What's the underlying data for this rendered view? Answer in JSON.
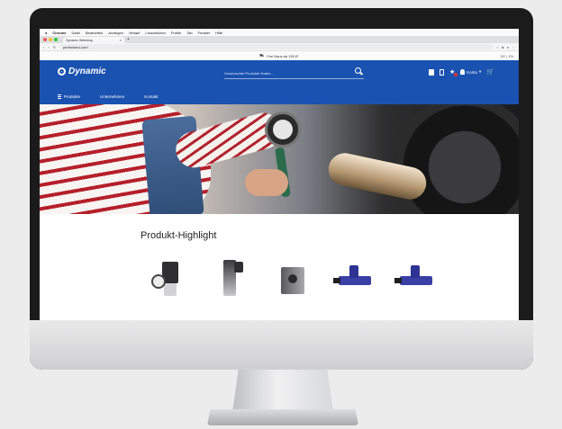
{
  "browser": {
    "menubar": [
      "Chrome",
      "Datei",
      "Bearbeiten",
      "Anzeigen",
      "Verlauf",
      "Lesezeichen",
      "Profile",
      "Tab",
      "Fenster",
      "Hilfe"
    ],
    "tab_title": "Dynamic Webshop",
    "tab_close": "×",
    "new_tab": "+",
    "url": "perfectaeo.com"
  },
  "promo": {
    "text": "Frei Haus ab 150 €*",
    "lang": "DE | EN"
  },
  "header": {
    "logo": "Dynamic",
    "search_placeholder": "Gewünschte Produkte finden...",
    "user_label": "Konto"
  },
  "nav": {
    "items": [
      "Produkte",
      "Unternehmen",
      "Kontakt"
    ]
  },
  "main": {
    "section_title": "Produkt-Highlight"
  },
  "colors": {
    "brand": "#1a52b1",
    "badge": "#e0302d"
  }
}
